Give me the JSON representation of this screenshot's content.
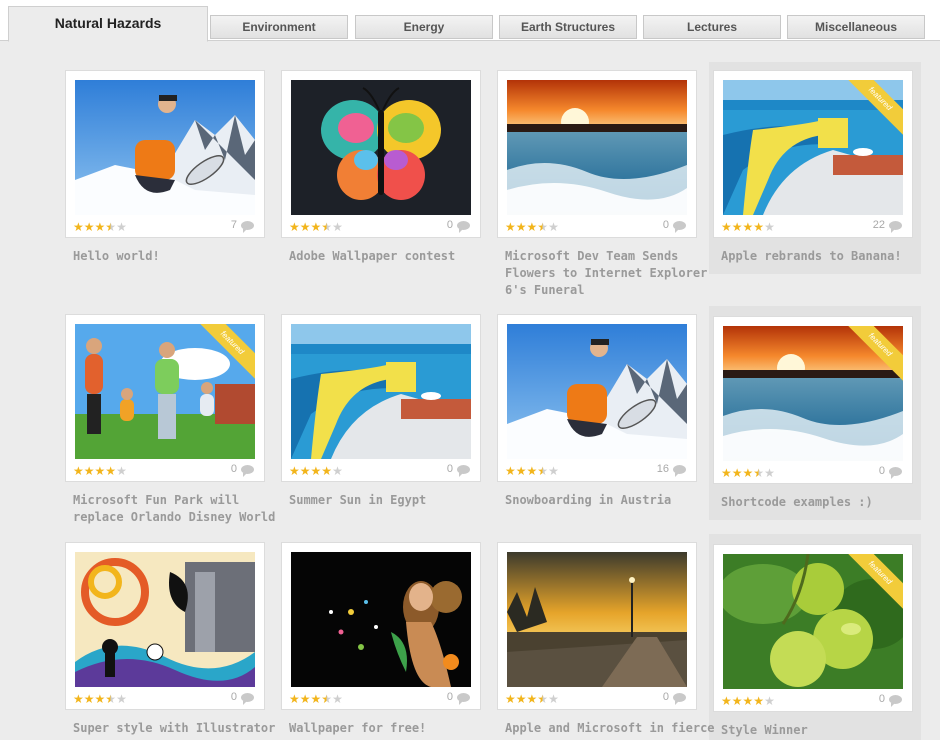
{
  "tabs": [
    {
      "label": "Natural Hazards",
      "active": true
    },
    {
      "label": "Environment",
      "active": false
    },
    {
      "label": "Energy",
      "active": false
    },
    {
      "label": "Earth Structures",
      "active": false
    },
    {
      "label": "Lectures",
      "active": false
    },
    {
      "label": "Miscellaneous",
      "active": false
    }
  ],
  "featured_label": "featured",
  "posts": [
    {
      "title": "Hello world!",
      "rating": 3.5,
      "comments": "7",
      "featured": false,
      "image": "snowboarder"
    },
    {
      "title": "Adobe Wallpaper contest",
      "rating": 3.5,
      "comments": "0",
      "featured": false,
      "image": "butterfly"
    },
    {
      "title": "Microsoft Dev Team Sends Flowers to Internet Explorer 6's Funeral",
      "rating": 3.5,
      "comments": "0",
      "featured": false,
      "image": "sunset-ocean"
    },
    {
      "title": "Apple rebrands to Banana!",
      "rating": 4,
      "comments": "22",
      "featured": true,
      "image": "infinity-pool"
    },
    {
      "title": "Microsoft Fun Park will replace Orlando Disney World",
      "rating": 4,
      "comments": "0",
      "featured": true,
      "image": "family-park"
    },
    {
      "title": "Summer Sun in Egypt",
      "rating": 4,
      "comments": "0",
      "featured": false,
      "image": "infinity-pool"
    },
    {
      "title": "Snowboarding in Austria",
      "rating": 3.5,
      "comments": "16",
      "featured": false,
      "image": "snowboarder"
    },
    {
      "title": "Shortcode examples :)",
      "rating": 3.5,
      "comments": "0",
      "featured": true,
      "image": "sunset-ocean"
    },
    {
      "title": "Super style with Illustrator",
      "rating": 3.5,
      "comments": "0",
      "featured": false,
      "image": "illustrator-art"
    },
    {
      "title": "Wallpaper for free!",
      "rating": 3.5,
      "comments": "0",
      "featured": false,
      "image": "wallpaper-girl"
    },
    {
      "title": "Apple and Microsoft in fierce",
      "rating": 3.5,
      "comments": "0",
      "featured": false,
      "image": "boardwalk-sunset"
    },
    {
      "title": "Style Winner",
      "rating": 4,
      "comments": "0",
      "featured": true,
      "image": "limes"
    }
  ],
  "colors": {
    "star_on": "#f2b51c",
    "star_off": "#cfcfcf",
    "ribbon": "#f2cc3a"
  }
}
